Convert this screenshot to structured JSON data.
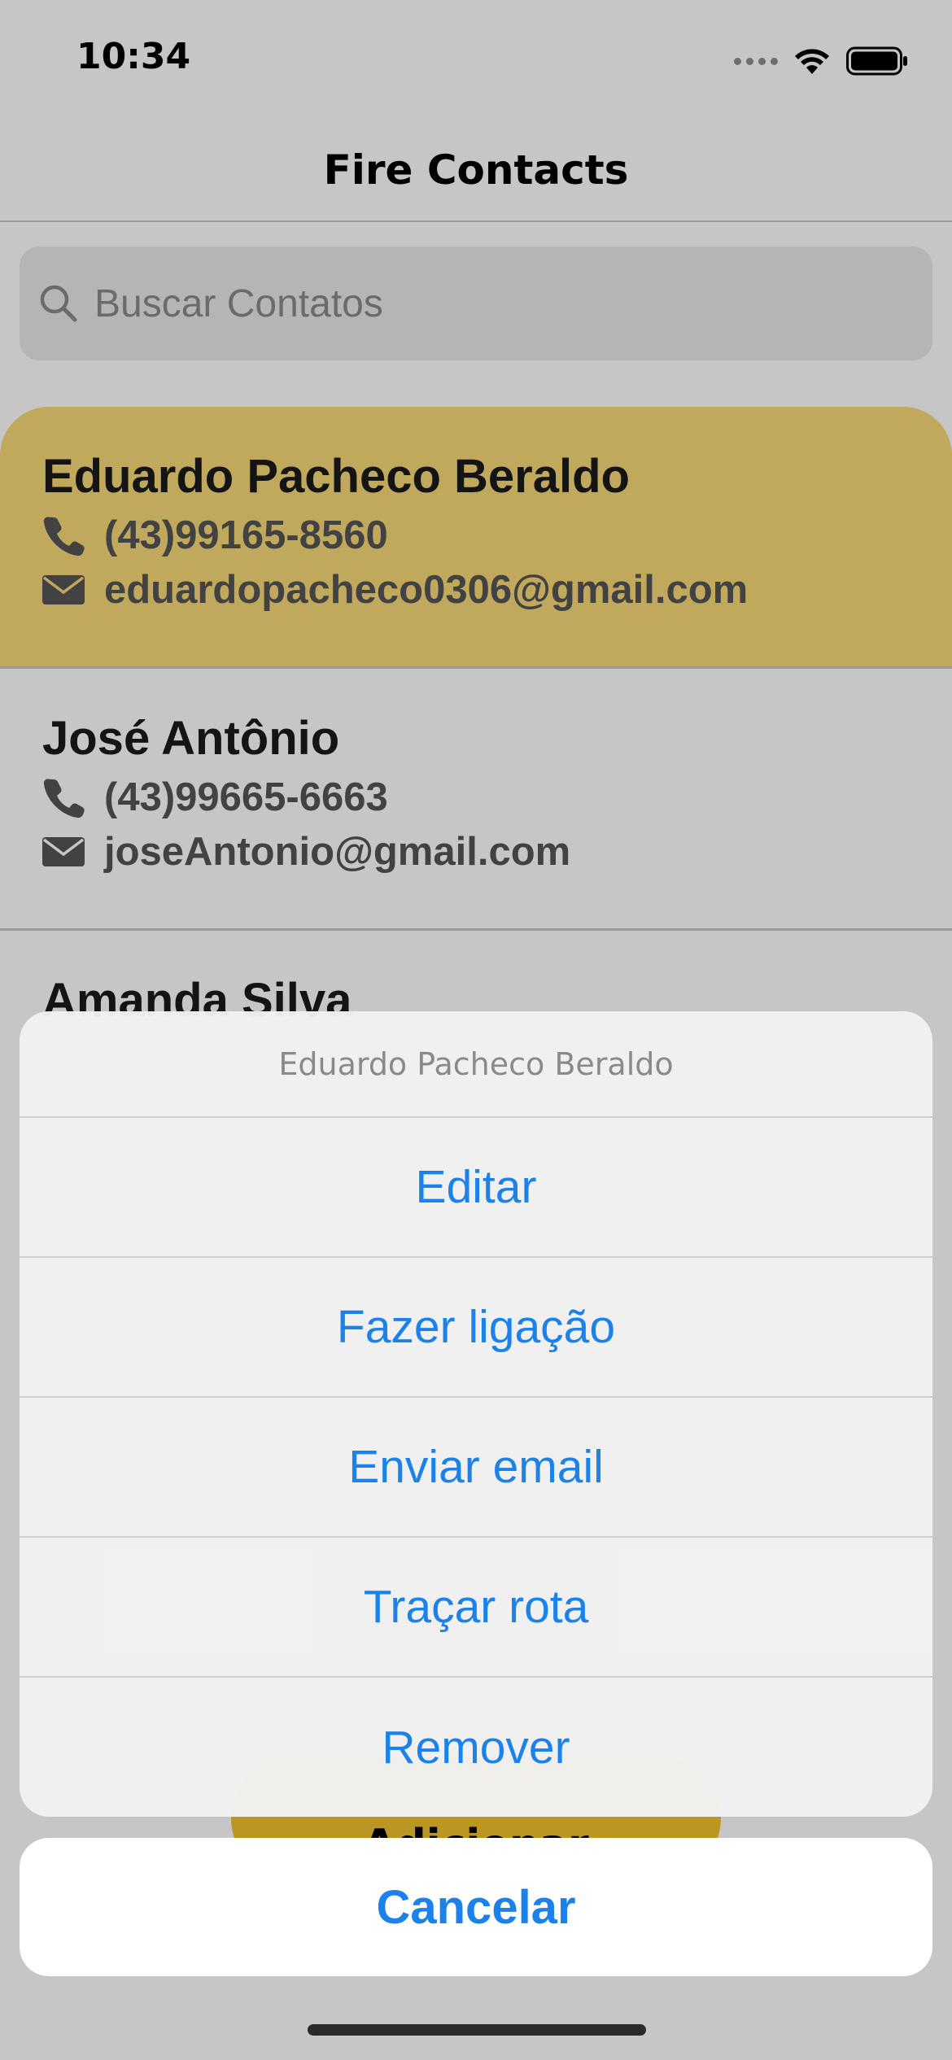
{
  "status_bar": {
    "time": "10:34",
    "icons": [
      "cellular-signal-icon",
      "wifi-icon",
      "battery-icon"
    ]
  },
  "nav": {
    "title": "Fire Contacts"
  },
  "search": {
    "placeholder": "Buscar Contatos",
    "icon": "search-icon"
  },
  "contacts": [
    {
      "name": "Eduardo Pacheco Beraldo",
      "phone": "(43)99165-8560",
      "email": "eduardopacheco0306@gmail.com",
      "selected": true
    },
    {
      "name": "José Antônio",
      "phone": "(43)99665-6663",
      "email": "joseAntonio@gmail.com",
      "selected": false
    },
    {
      "name": "Amanda Silva"
    }
  ],
  "fab": {
    "label": "Adicionar"
  },
  "action_sheet": {
    "title": "Eduardo Pacheco Beraldo",
    "actions": [
      "Editar",
      "Fazer ligação",
      "Enviar email",
      "Traçar rota",
      "Remover"
    ],
    "cancel": "Cancelar"
  },
  "colors": {
    "selected_card": "#f8da78",
    "accent_blue": "#1a82ea",
    "fab_yellow": "#f2c12e"
  }
}
